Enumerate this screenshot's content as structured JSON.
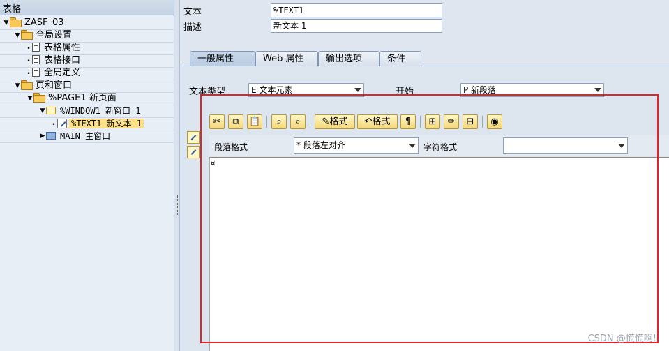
{
  "tree": {
    "header": "表格",
    "nodes": [
      {
        "label": "ZASF_03"
      },
      {
        "label": "全局设置"
      },
      {
        "label": "表格属性"
      },
      {
        "label": "表格接口"
      },
      {
        "label": "全局定义"
      },
      {
        "label": "页和窗口"
      },
      {
        "label": "%PAGE1 新页面"
      },
      {
        "label": "%WINDOW1 新窗口 1"
      },
      {
        "label": "%TEXT1 新文本 1"
      },
      {
        "label": "MAIN 主窗口"
      }
    ]
  },
  "header_fields": {
    "text_label": "文本",
    "text_value": "%TEXT1",
    "desc_label": "描述",
    "desc_value": "新文本 1"
  },
  "tabs": [
    {
      "label": "一般属性"
    },
    {
      "label": "Web 属性"
    },
    {
      "label": "输出选项"
    },
    {
      "label": "条件"
    }
  ],
  "general": {
    "text_type_label": "文本类型",
    "text_type_value": "E 文本元素",
    "start_label": "开始",
    "start_value": "P 新段落"
  },
  "toolbar": {
    "format_btn1": "格式",
    "format_btn2": "格式",
    "paragraph_mark": "¶"
  },
  "format_bar": {
    "paragraph_label": "段落格式",
    "paragraph_value": "* 段落左对齐",
    "char_label": "字符格式",
    "char_value": ""
  },
  "editor": {
    "cursor_mark": "¤"
  },
  "watermark": "CSDN @慌慌啊!"
}
